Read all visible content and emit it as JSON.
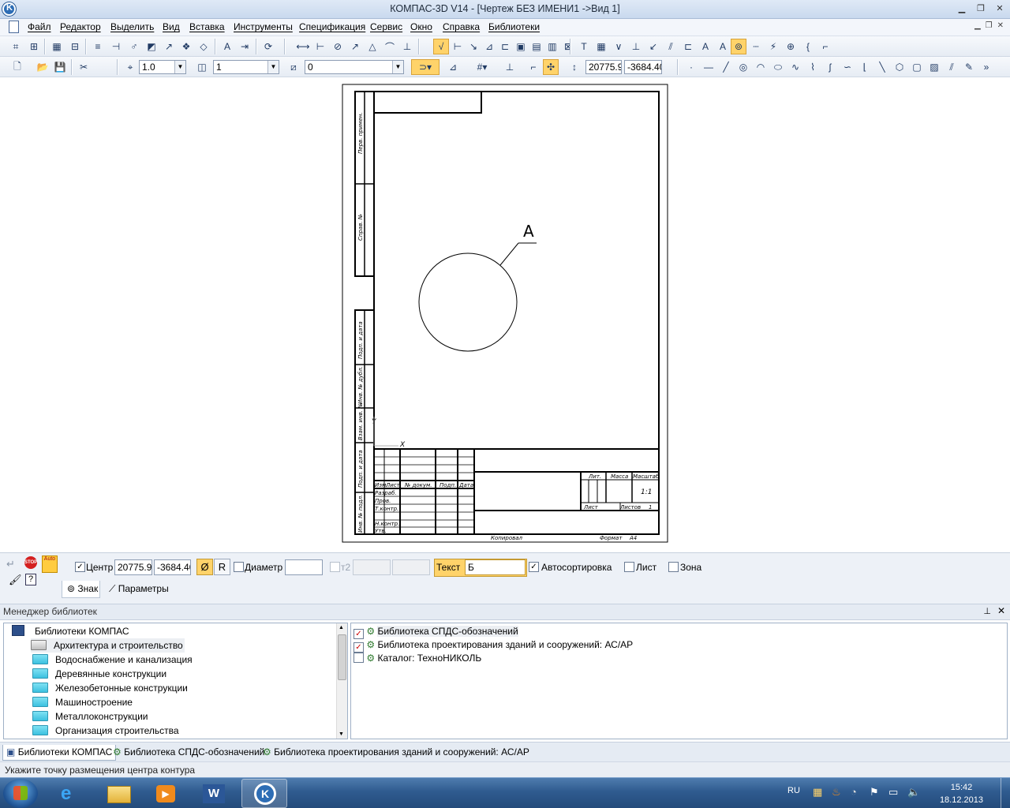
{
  "window": {
    "title": "КОМПАС-3D V14 - [Чертеж БЕЗ ИМЕНИ1 ->Вид 1]"
  },
  "menu": [
    "Файл",
    "Редактор",
    "Выделить",
    "Вид",
    "Вставка",
    "Инструменты",
    "Спецификация",
    "Сервис",
    "Окно",
    "Справка",
    "Библиотеки"
  ],
  "toolbar": {
    "scale_value": "1.0",
    "layer_value": "1",
    "style_value": "0",
    "coord_x": "20775.9",
    "coord_y": "-3684.40"
  },
  "drawing": {
    "leader_label": "А",
    "side_labels": [
      "Перв. примен.",
      "Справ. №",
      "Подп. и дата",
      "Инв. № дубл.",
      "Взам. инв. №",
      "Подп. и дата",
      "Инв. № подл."
    ],
    "titleblock_cols": [
      "Изм.",
      "Лист",
      "№ докум.",
      "Подп.",
      "Дата"
    ],
    "titleblock_rows": [
      "Разраб.",
      "Пров.",
      "Т.контр.",
      "Н.контр.",
      "Утв."
    ],
    "titleblock_right": {
      "lit": "Лит.",
      "mass": "Масса",
      "scale": "Масштаб",
      "scale_value": "1:1",
      "sheet": "Лист",
      "sheets": "Листов",
      "sheets_value": "1"
    },
    "footer_copy": "Копировал",
    "footer_format": "Формат",
    "footer_format_value": "A4"
  },
  "properties": {
    "center_label": "Центр",
    "center_checked": true,
    "center_x": "20775.9",
    "center_y": "-3684.40",
    "diameter_symbol": "Ø",
    "radius_symbol": "R",
    "diameter_label": "Диаметр",
    "diameter_value": "",
    "t2_label": "т2",
    "text_label": "Текст",
    "text_value": "Б",
    "autosort_label": "Автосортировка",
    "autosort_checked": true,
    "sheet_label": "Лист",
    "zone_label": "Зона",
    "tabs": [
      "Знак",
      "Параметры"
    ]
  },
  "library_manager": {
    "title": "Менеджер библиотек",
    "root": "Библиотеки КОМПАС",
    "folders": [
      "Архитектура и строительство",
      "Водоснабжение и канализация",
      "Деревянные конструкции",
      "Железобетонные конструкции",
      "Машиностроение",
      "Металлоконструкции",
      "Организация строительства"
    ],
    "selected_folder": "Архитектура и строительство",
    "libraries": [
      {
        "name": "Библиотека СПДС-обозначений",
        "checked": true
      },
      {
        "name": "Библиотека проектирования зданий и сооружений: АС/АР",
        "checked": true
      },
      {
        "name": "Каталог: ТехноНИКОЛЬ",
        "checked": false
      }
    ],
    "bottom_tabs": [
      "Библиотеки КОМПАС",
      "Библиотека СПДС-обозначений",
      "Библиотека проектирования зданий и сооружений: АС/АР"
    ]
  },
  "status": "Укажите точку размещения центра контура",
  "taskbar": {
    "lang": "RU",
    "time": "15:42",
    "date": "18.12.2013"
  }
}
